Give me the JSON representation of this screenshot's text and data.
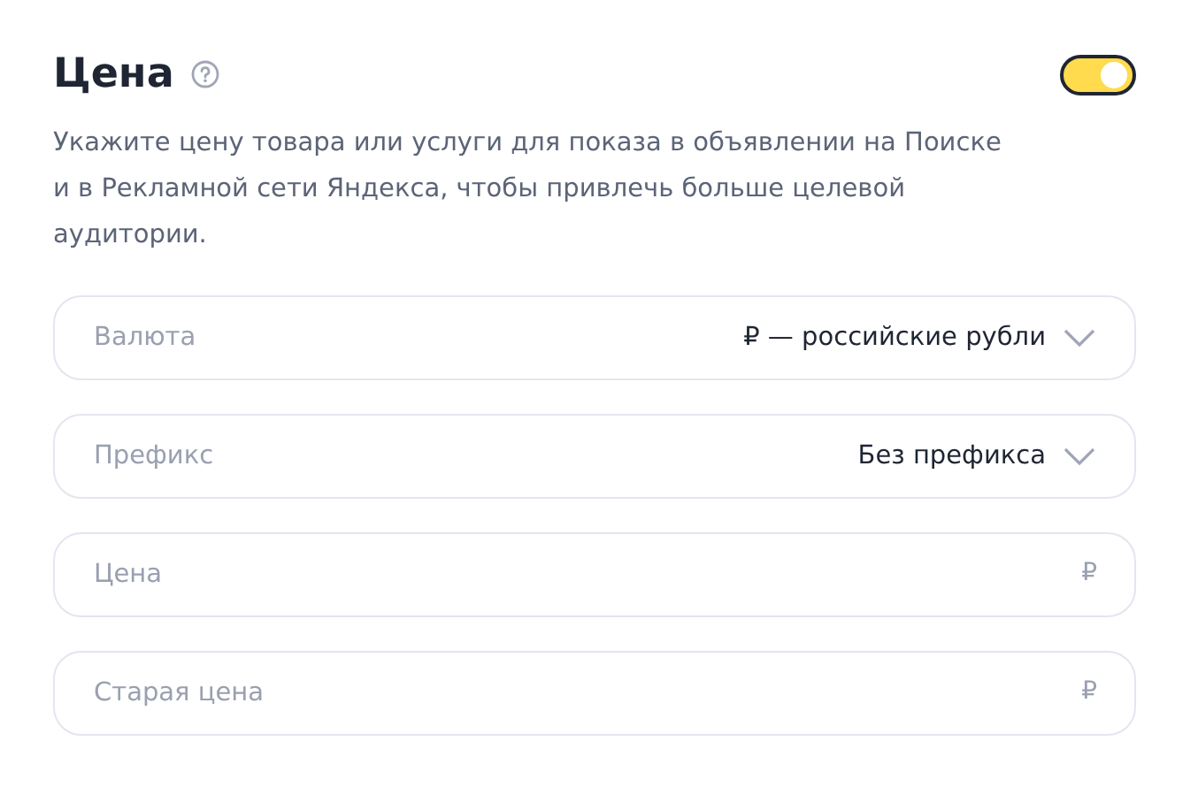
{
  "section": {
    "title": "Цена",
    "enabled": true,
    "description": "Укажите цену товара или услуги для показа в объявлении на Поиске и в Рекламной сети Яндекса, чтобы привлечь больше целевой аудитории."
  },
  "fields": [
    {
      "kind": "select",
      "label": "Валюта",
      "value": "₽ — российские рубли"
    },
    {
      "kind": "select",
      "label": "Префикс",
      "value": "Без префикса"
    },
    {
      "kind": "input",
      "placeholder": "Цена",
      "suffix": "₽"
    },
    {
      "kind": "input",
      "placeholder": "Старая цена",
      "suffix": "₽"
    }
  ]
}
